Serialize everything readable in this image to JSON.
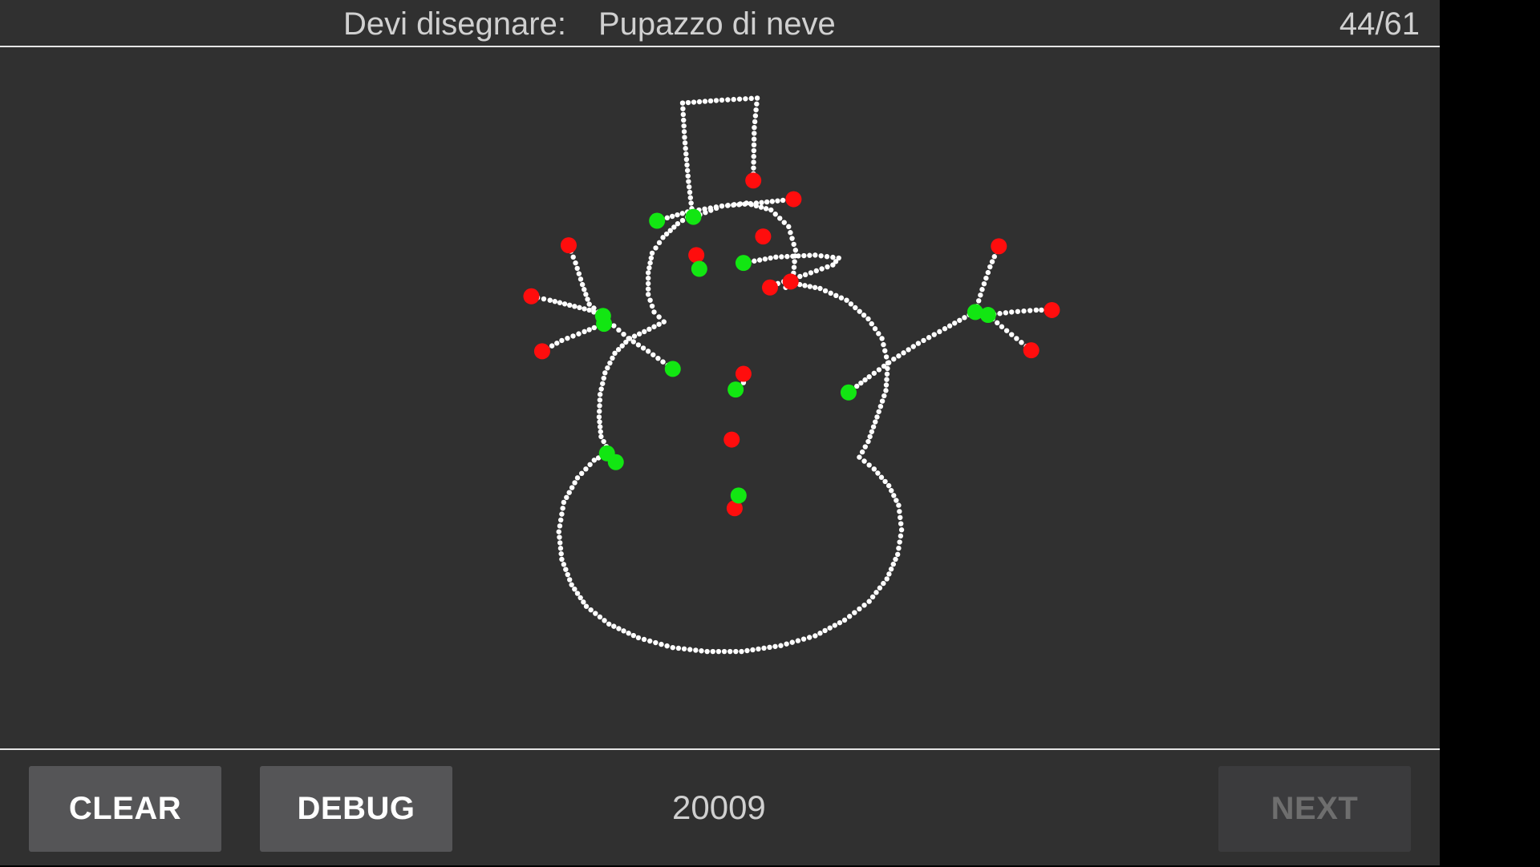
{
  "header": {
    "prompt_label": "Devi disegnare:",
    "prompt_word": "Pupazzo di neve",
    "progress": "44/61"
  },
  "footer": {
    "clear_label": "CLEAR",
    "debug_label": "DEBUG",
    "counter": "20009",
    "next_label": "NEXT"
  },
  "colors": {
    "background": "#303030",
    "stroke": "#ffffff",
    "stroke_start": "#12e612",
    "stroke_end": "#ff0d0d",
    "button": "#555557",
    "button_disabled": "#3b3b3d"
  }
}
